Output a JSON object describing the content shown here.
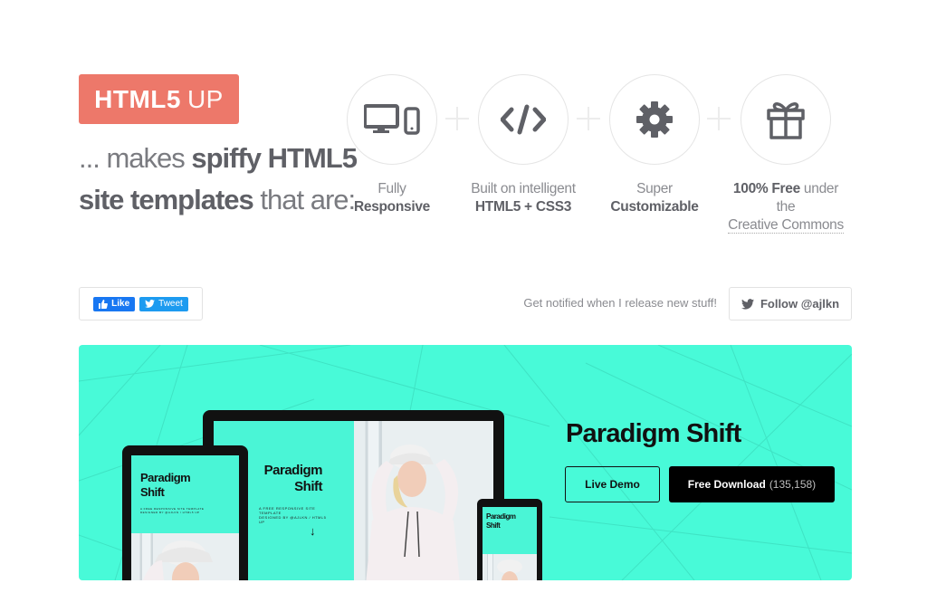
{
  "logo": {
    "bold": "HTML5",
    "light": "UP"
  },
  "tagline": {
    "prefix": "... makes ",
    "strong1": "spiffy HTML5",
    "strong2": "site templates",
    "suffix": " that are:"
  },
  "features": [
    {
      "icon": "responsive-devices-icon",
      "line1": "Fully",
      "line2": "Responsive"
    },
    {
      "icon": "code-icon",
      "line1": "Built on intelligent",
      "line2": "HTML5 + CSS3"
    },
    {
      "icon": "gear-icon",
      "line1": "Super",
      "line2": "Customizable"
    },
    {
      "icon": "gift-icon",
      "line1_bold": "100% Free",
      "line1_rest": " under the",
      "line2": "Creative Commons"
    }
  ],
  "social": {
    "like_label": "Like",
    "tweet_label": "Tweet"
  },
  "notify_text": "Get notified when I release new stuff!",
  "follow_label": "Follow @ajlkn",
  "banner": {
    "accent_color": "#48fad8",
    "title": "Paradigm Shift",
    "demo_label": "Live Demo",
    "download_label": "Free Download",
    "download_count": "(135,158)",
    "mock_title_line1": "Paradigm",
    "mock_title_line2": "Shift",
    "mock_subtitle_line1": "A FREE RESPONSIVE SITE TEMPLATE",
    "mock_subtitle_line2": "DESIGNED BY @AJLKN / HTML5 UP",
    "mock_arrow": "↓"
  },
  "colors": {
    "logo_bg": "#ed786a",
    "text": "#5f6066",
    "button_dark": "#000000"
  }
}
